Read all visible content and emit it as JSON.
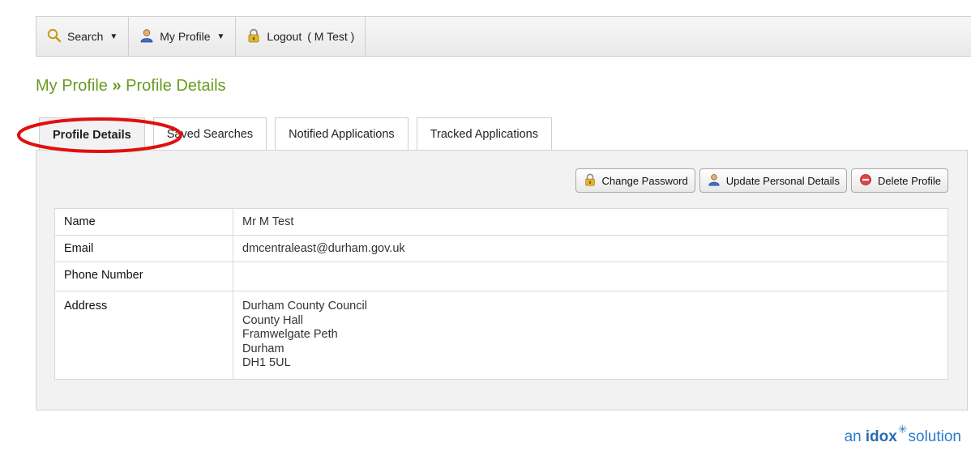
{
  "toolbar": {
    "search_label": "Search",
    "profile_label": "My Profile",
    "logout_label": "Logout",
    "logout_user": "( M Test )"
  },
  "page": {
    "title_section": "My Profile",
    "title_separator": "»",
    "title_page": "Profile Details"
  },
  "tabs": [
    {
      "label": "Profile Details",
      "active": true
    },
    {
      "label": "Saved Searches",
      "active": false
    },
    {
      "label": "Notified Applications",
      "active": false
    },
    {
      "label": "Tracked Applications",
      "active": false
    }
  ],
  "actions": {
    "change_password": "Change Password",
    "update_details": "Update Personal Details",
    "delete_profile": "Delete Profile"
  },
  "details": {
    "name_label": "Name",
    "name_value": "Mr M Test",
    "email_label": "Email",
    "email_value": "dmcentraleast@durham.gov.uk",
    "phone_label": "Phone Number",
    "phone_value": "",
    "address_label": "Address",
    "address_lines": [
      "Durham County Council",
      "County Hall",
      "Framwelgate Peth",
      "Durham",
      "DH1 5UL"
    ]
  },
  "footer": {
    "logo_prefix": "an",
    "logo_brand": "idox",
    "logo_suffix": "solution"
  },
  "colors": {
    "title_green": "#6b9a1f",
    "annotation_red": "#e01010",
    "logo_blue": "#2b7ec9"
  },
  "icons": {
    "search": "magnifier-icon",
    "profile": "user-icon",
    "logout": "padlock-icon",
    "delete": "red-circle-icon"
  }
}
